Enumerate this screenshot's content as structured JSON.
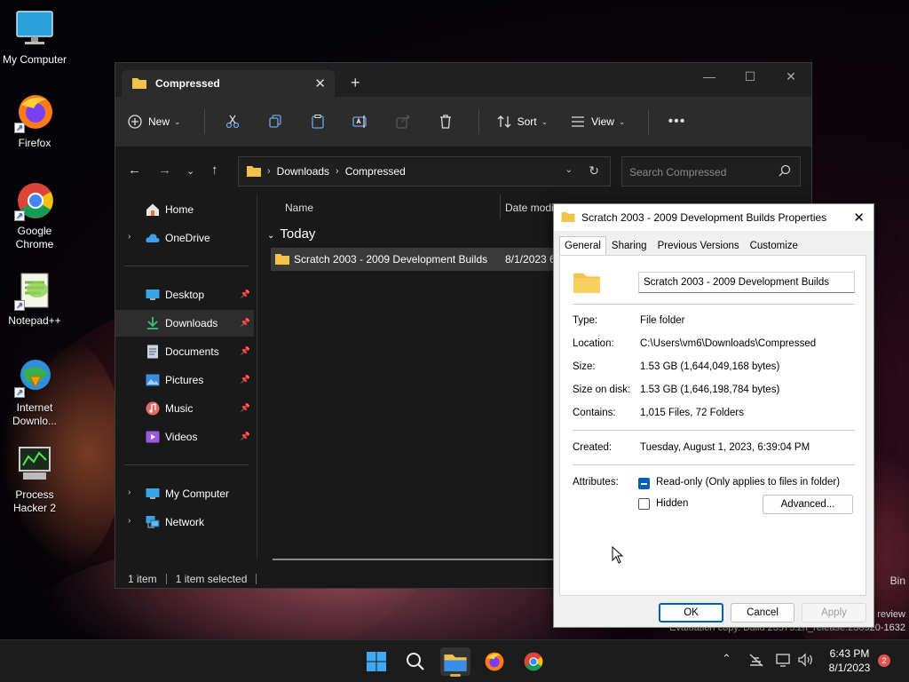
{
  "desktop": {
    "icons": [
      {
        "label": "My Computer"
      },
      {
        "label": "Firefox"
      },
      {
        "label": "Google Chrome"
      },
      {
        "label": "Notepad++"
      },
      {
        "label": "Internet Downlo..."
      },
      {
        "label": "Process Hacker 2"
      }
    ],
    "recycle_bin_partial": "Bin",
    "watermark": {
      "line1": "review",
      "line2": "Evaluation copy. Build 23575.zn_release.230920-1632"
    }
  },
  "explorer": {
    "tab_title": "Compressed",
    "toolbar": {
      "new_label": "New",
      "sort_label": "Sort",
      "view_label": "View"
    },
    "breadcrumb": [
      "Downloads",
      "Compressed"
    ],
    "search_placeholder": "Search Compressed",
    "nav": {
      "home": "Home",
      "onedrive": "OneDrive",
      "desktop": "Desktop",
      "downloads": "Downloads",
      "documents": "Documents",
      "pictures": "Pictures",
      "music": "Music",
      "videos": "Videos",
      "my_computer": "My Computer",
      "network": "Network"
    },
    "columns": {
      "name": "Name",
      "date": "Date modi"
    },
    "group": "Today",
    "files": [
      {
        "name": "Scratch 2003 - 2009 Development Builds",
        "date": "8/1/2023 6"
      }
    ],
    "status": {
      "count": "1 item",
      "selected": "1 item selected"
    }
  },
  "properties": {
    "title": "Scratch 2003 - 2009 Development Builds Properties",
    "tabs": [
      "General",
      "Sharing",
      "Previous Versions",
      "Customize"
    ],
    "folder_name": "Scratch 2003 - 2009 Development Builds",
    "labels": {
      "type": "Type:",
      "location": "Location:",
      "size": "Size:",
      "size_on_disk": "Size on disk:",
      "contains": "Contains:",
      "created": "Created:",
      "attributes": "Attributes:"
    },
    "values": {
      "type": "File folder",
      "location": "C:\\Users\\vm6\\Downloads\\Compressed",
      "size": "1.53 GB (1,644,049,168 bytes)",
      "size_on_disk": "1.53 GB (1,646,198,784 bytes)",
      "contains": "1,015 Files, 72 Folders",
      "created": "Tuesday, August 1, 2023, 6:39:04 PM"
    },
    "attr_readonly": "Read-only (Only applies to files in folder)",
    "attr_hidden": "Hidden",
    "advanced_label": "Advanced...",
    "ok_label": "OK",
    "cancel_label": "Cancel",
    "apply_label": "Apply"
  },
  "taskbar": {
    "time": "6:43 PM",
    "date": "8/1/2023",
    "notification_count": "2"
  }
}
